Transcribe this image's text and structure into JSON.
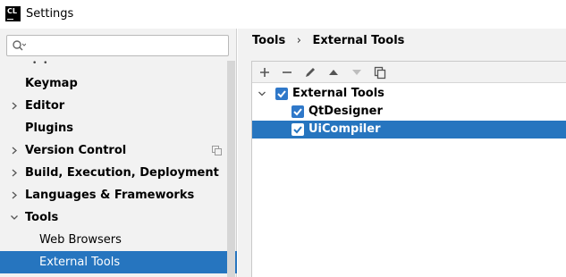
{
  "window": {
    "title": "Settings",
    "app_icon_text": "CL"
  },
  "search": {
    "placeholder": ""
  },
  "sidebar": {
    "items": [
      {
        "label": "Keymap",
        "expandable": false
      },
      {
        "label": "Editor",
        "expandable": true
      },
      {
        "label": "Plugins",
        "expandable": false
      },
      {
        "label": "Version Control",
        "expandable": true
      },
      {
        "label": "Build, Execution, Deployment",
        "expandable": true
      },
      {
        "label": "Languages & Frameworks",
        "expandable": true
      },
      {
        "label": "Tools",
        "expandable": true,
        "expanded": true
      },
      {
        "label": "Web Browsers",
        "child": true
      },
      {
        "label": "External Tools",
        "child": true,
        "selected": true
      }
    ]
  },
  "breadcrumb": {
    "parent": "Tools",
    "separator": "›",
    "current": "External Tools"
  },
  "toolbar": {
    "buttons": [
      "add-icon",
      "remove-icon",
      "edit-icon",
      "move-up-icon",
      "move-down-icon",
      "copy-icon"
    ]
  },
  "tree": {
    "root": {
      "label": "External Tools",
      "checked": true,
      "expanded": true
    },
    "children": [
      {
        "label": "QtDesigner",
        "checked": true,
        "selected": false
      },
      {
        "label": "UiCompiler",
        "checked": true,
        "selected": true
      }
    ]
  },
  "colors": {
    "selection": "#2675bf",
    "checkbox": "#2f78c9",
    "panel_bg": "#f2f2f2"
  }
}
